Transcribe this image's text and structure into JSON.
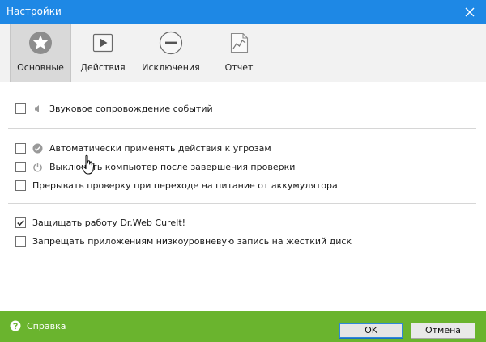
{
  "window": {
    "title": "Настройки"
  },
  "tabs": [
    {
      "label": "Основные",
      "icon": "star-icon",
      "active": true
    },
    {
      "label": "Действия",
      "icon": "play-icon",
      "active": false
    },
    {
      "label": "Исключения",
      "icon": "minus-circle-icon",
      "active": false
    },
    {
      "label": "Отчет",
      "icon": "report-chart-icon",
      "active": false
    }
  ],
  "options": [
    {
      "label": "Звуковое сопровождение событий",
      "checked": false,
      "icon": "speaker-icon"
    },
    {
      "label": "Автоматически применять действия к угрозам",
      "checked": false,
      "icon": "check-circle-icon"
    },
    {
      "label": "Выключать компьютер после завершения проверки",
      "checked": false,
      "icon": "power-icon"
    },
    {
      "label": "Прерывать проверку при переходе на питание от аккумулятора",
      "checked": false
    },
    {
      "label": "Защищать работу Dr.Web CureIt!",
      "checked": true
    },
    {
      "label": "Запрещать приложениям низкоуровневую запись на жесткий диск",
      "checked": false
    }
  ],
  "footer": {
    "help_label": "Справка",
    "ok_label": "OK",
    "cancel_label": "Отмена"
  },
  "colors": {
    "titlebar": "#1e88e5",
    "footer": "#6ab42e",
    "active_tab": "#d9d9d9"
  }
}
